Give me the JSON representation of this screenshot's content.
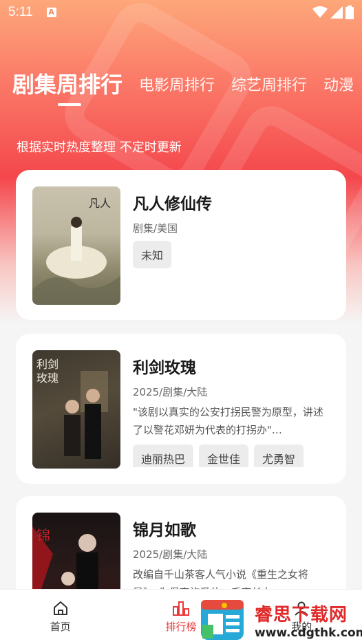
{
  "status_bar": {
    "time": "5:11",
    "notification_icon": "A"
  },
  "tabs": [
    {
      "label": "剧集周排行",
      "active": true
    },
    {
      "label": "电影周排行",
      "active": false
    },
    {
      "label": "综艺周排行",
      "active": false
    },
    {
      "label": "动漫",
      "active": false
    }
  ],
  "subtitle": "根据实时热度整理 不定时更新",
  "items": [
    {
      "title": "凡人修仙传",
      "meta": "剧集/美国",
      "desc": "",
      "tags": [
        "未知"
      ]
    },
    {
      "title": "利剑玫瑰",
      "meta": "2025/剧集/大陆",
      "desc": "\"该剧以真实的公安打拐民警为原型，讲述了以警花邓妍为代表的打拐办\"…",
      "tags": [
        "迪丽热巴",
        "金世佳",
        "尤勇智"
      ]
    },
    {
      "title": "锦月如歌",
      "meta": "2025/剧集/大陆",
      "desc": "改编自千山茶客人气小说《重生之女将星》，为保家族爱位，千家长女",
      "tags": []
    }
  ],
  "nav": {
    "home": "首页",
    "ranking": "排行榜",
    "mine": "我的"
  },
  "watermark": {
    "title": "睿思下载网",
    "url": "www.cdgthk.com"
  },
  "colors": {
    "accent": "#e8393b",
    "header_top": "#fda77a",
    "header_mid": "#f4474c"
  }
}
